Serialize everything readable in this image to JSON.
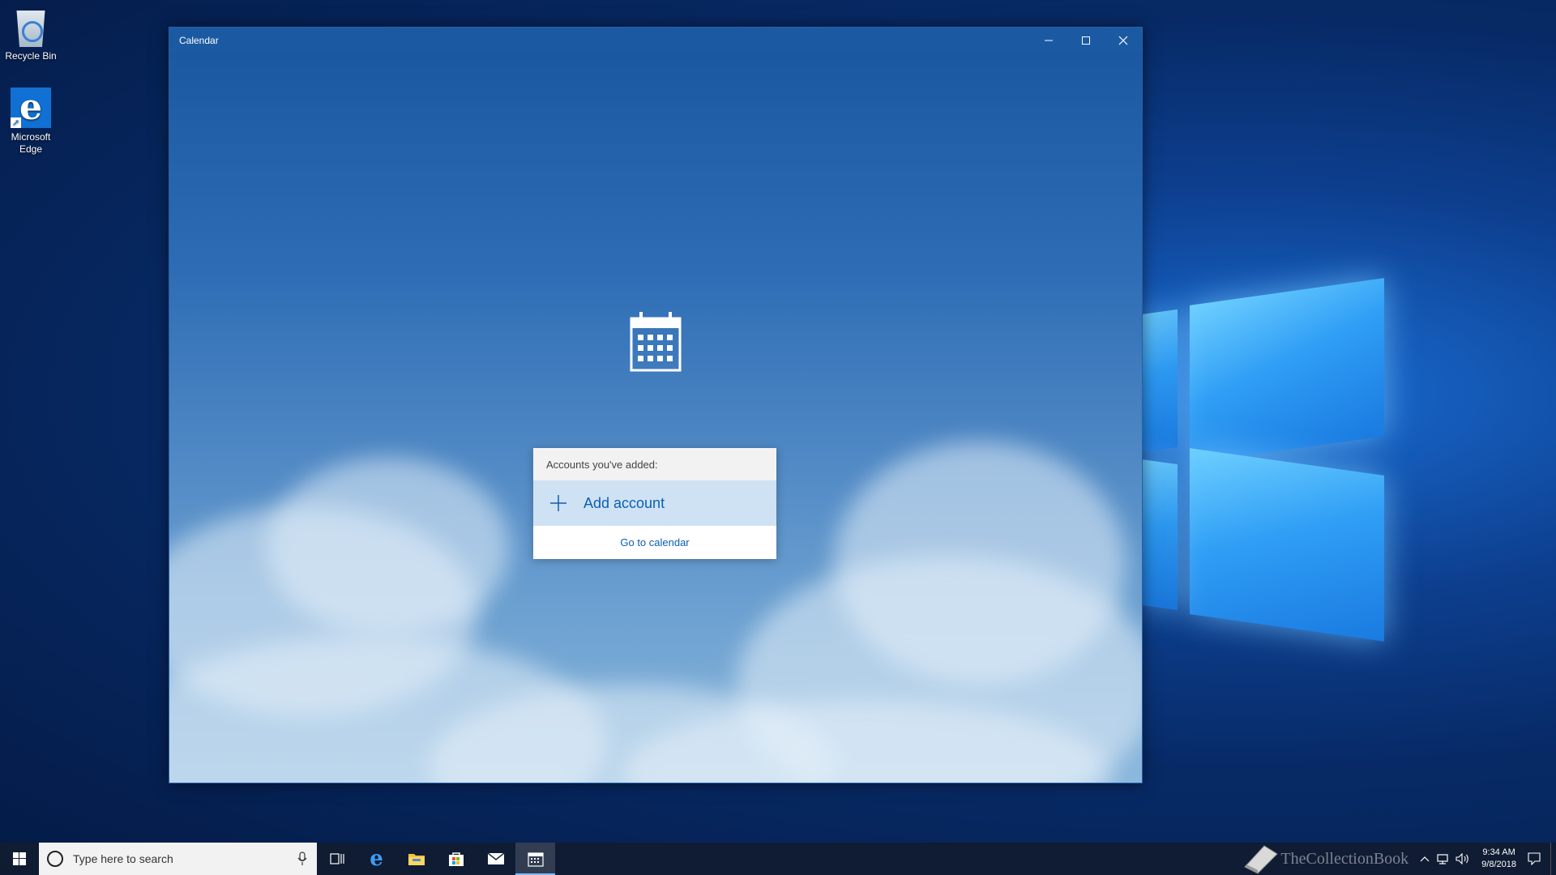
{
  "desktop": {
    "icons": [
      {
        "label": "Recycle Bin",
        "icon": "recycle-bin-icon"
      },
      {
        "label": "Microsoft Edge",
        "icon": "edge-icon"
      }
    ]
  },
  "window": {
    "title": "Calendar",
    "controls": [
      "minimize-icon",
      "maximize-icon",
      "close-icon"
    ]
  },
  "welcome": {
    "icon": "calendar-icon",
    "accounts_header": "Accounts you've added:",
    "add_account_label": "Add account",
    "go_to_calendar_label": "Go to calendar"
  },
  "taskbar": {
    "search_placeholder": "Type here to search",
    "pinned": [
      "task-view-icon",
      "edge-icon",
      "file-explorer-icon",
      "store-icon",
      "mail-icon",
      "calendar-icon"
    ],
    "active_app": "calendar",
    "watermark": "TheCollectionBook",
    "clock": {
      "time": "9:34 AM",
      "date": "9/8/2018"
    }
  },
  "colors": {
    "titlebar": "#1b5aa3",
    "accent": "#0a5fb4",
    "add_row_bg": "#cfe2f3"
  }
}
